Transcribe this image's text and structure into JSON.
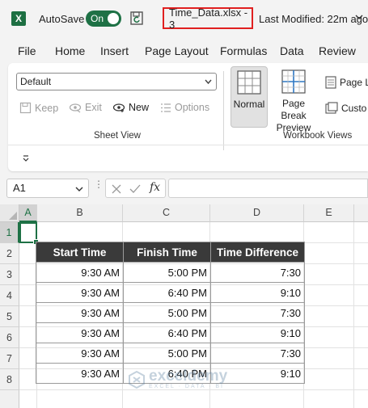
{
  "titlebar": {
    "app_letter": "X",
    "autosave_label": "AutoSave",
    "autosave_state": "On",
    "filename": "Time_Data.xlsx  -  3",
    "last_modified": "Last Modified: 22m ago"
  },
  "menu": [
    "File",
    "Home",
    "Insert",
    "Page Layout",
    "Formulas",
    "Data",
    "Review"
  ],
  "ribbon": {
    "sheet_view": {
      "dropdown_value": "Default",
      "keep": "Keep",
      "exit": "Exit",
      "new": "New",
      "options": "Options",
      "group_label": "Sheet View"
    },
    "workbook_views": {
      "normal": "Normal",
      "page_break_line1": "Page Break",
      "page_break_line2": "Preview",
      "page_layout": "Page L",
      "custom": "Custo",
      "group_label": "Workbook Views"
    }
  },
  "formula_bar": {
    "name_box": "A1",
    "fx": "fx",
    "value": ""
  },
  "sheet": {
    "columns": [
      "A",
      "B",
      "C",
      "D",
      "E"
    ],
    "rows": [
      "1",
      "2",
      "3",
      "4",
      "5",
      "6",
      "7",
      "8"
    ],
    "table": {
      "headers": [
        "Start Time",
        "Finish Time",
        "Time Difference"
      ],
      "rows": [
        [
          "9:30 AM",
          "5:00 PM",
          "7:30"
        ],
        [
          "9:30 AM",
          "6:40 PM",
          "9:10"
        ],
        [
          "9:30 AM",
          "5:00 PM",
          "7:30"
        ],
        [
          "9:30 AM",
          "6:40 PM",
          "9:10"
        ],
        [
          "9:30 AM",
          "5:00 PM",
          "7:30"
        ],
        [
          "9:30 AM",
          "6:40 PM",
          "9:10"
        ]
      ]
    }
  },
  "watermark": {
    "brand": "exceldemy",
    "tagline": "EXCEL · DATA · BI"
  },
  "colors": {
    "excel_green": "#1e7145",
    "header_fill": "#3a3a3a",
    "highlight_red": "#e02020"
  }
}
